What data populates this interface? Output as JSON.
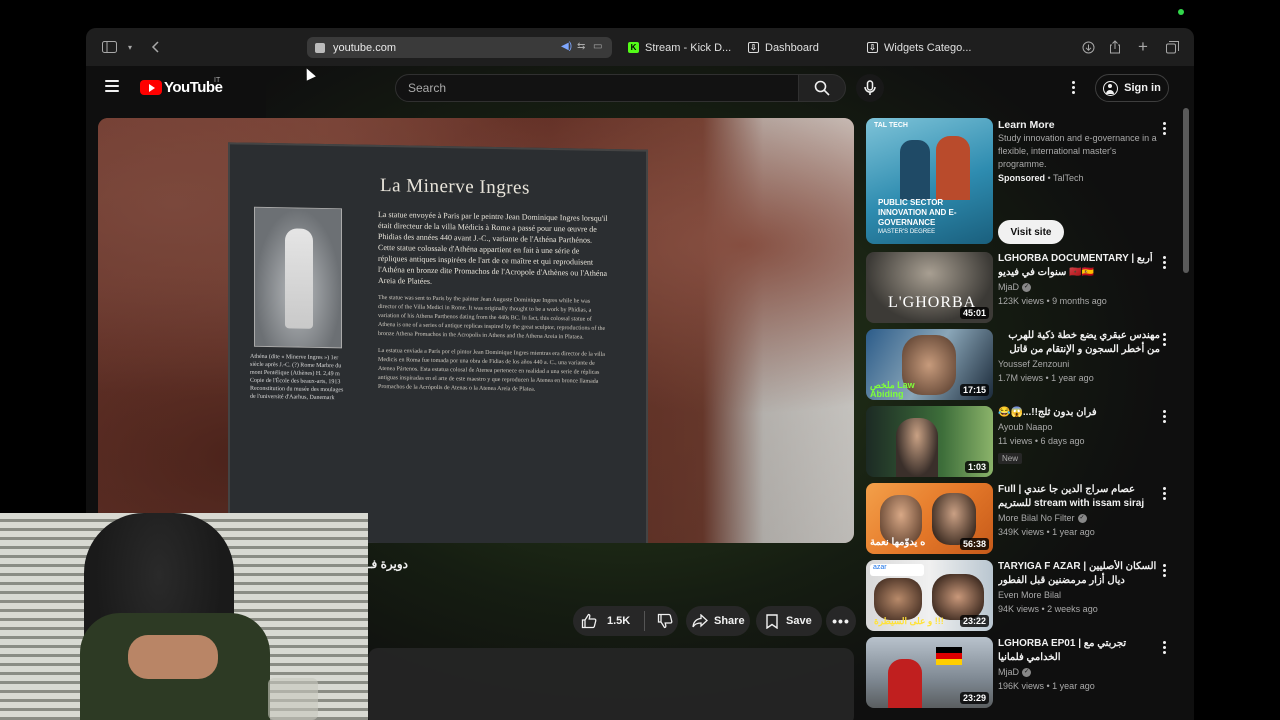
{
  "browser": {
    "address": "youtube.com",
    "tabs": [
      {
        "label": "Stream - Kick D...",
        "color": "#53fc18"
      },
      {
        "label": "Dashboard",
        "color": "#dddddd"
      },
      {
        "label": "Widgets Catego...",
        "color": "#dddddd"
      }
    ],
    "icons": [
      "sidebar-icon",
      "back-icon",
      "download-icon",
      "share-icon",
      "new-tab-icon",
      "tabs-overview-icon"
    ]
  },
  "yt": {
    "logo_text": "YouTube",
    "country_code": "IT",
    "search_placeholder": "Search",
    "signin_label": "Sign in",
    "brand_color": "#ff0000"
  },
  "video": {
    "plaque_title": "La Minerve Ingres",
    "plaque_fr": "La statue envoyée à Paris par le peintre Jean Dominique Ingres lorsqu'il était directeur de la villa Médicis à Rome a passé pour une œuvre de Phidias des années 440 avant J.-C., variante de l'Athéna Parthénos. Cette statue colossale d'Athéna appartient en fait à une série de répliques antiques inspirées de l'art de ce maître et qui reproduisent l'Athéna en bronze dite Promachos de l'Acropole d'Athènes ou l'Athéna Areia de Platées.",
    "plaque_en": "The statue was sent to Paris by the painter Jean Auguste Dominique Ingres while he was director of the Villa Medici in Rome. It was originally thought to be a work by Phidias, a variation of his Athena Parthenos dating from the 440s BC. In fact, this colossal statue of Athena is one of a series of antique replicas inspired by the great sculptor, reproductions of the bronze Athena Promachos in the Acropolis in Athens and the Athena Areia in Plataea.",
    "plaque_es": "La estatua enviada a París por el pintor Jean Dominique Ingres mientras era director de la villa Medicis en Roma fue tomada por una obra de Fidias de los años 440 a. C., una variante de Atenea Pártenos. Esta estatua colosal de Atenea pertenece en realidad a una serie de réplicas antiguas inspiradas en el arte de este maestro y que reproducen la Atenea en bronce llamada Promachos de la Acrópolis de Atenas o la Atenea Areia de Platea.",
    "plaque_caption": "Athéna (dite « Minerve Ingres »)  1er siècle après J.-C. (?)  Rome  Marbre du mont Pentélique (Athènes)  H. 2,49 m  Copie de l'École des beaux-arts, 1913  Reconstitution du musée des moulages de l'université d'Aarhus, Danemark",
    "title": "دويرة فـ",
    "likes": "1.5K",
    "share_label": "Share",
    "save_label": "Save"
  },
  "sidebar": {
    "ad": {
      "title": "Learn More",
      "body": "Study innovation and e-governance in a flexible, international master's programme.",
      "sponsored": "Sponsored",
      "advertiser": "TalTech",
      "cta": "Visit site",
      "thumb_text": "PUBLIC SECTOR INNOVATION AND E-GOVERNANCE",
      "thumb_sub": "MASTER'S DEGREE",
      "thumb_brand": "TAL TECH"
    },
    "videos": [
      {
        "title": "LGHORBA DOCUMENTARY | أربع سنوات في فيديو 🇲🇦🇪🇸",
        "channel": "MjaD",
        "verified": true,
        "meta": "123K views • 9 months ago",
        "duration": "45:01",
        "thumb_text": "L'GHORBA",
        "new": ""
      },
      {
        "title": "مهندس عبقري يضع خطة ذكية للهرب من أخطر السجون و الإنتقام من قاتل إبنته😱|...",
        "channel": "Youssef Zenzouni",
        "verified": false,
        "meta": "1.7M views • 1 year ago",
        "duration": "17:15",
        "thumb_text": "ملخص Law Abiding",
        "new": ""
      },
      {
        "title": "😂😱...!!فران بدون ثلج",
        "channel": "Ayoub Naapo",
        "verified": false,
        "meta": "11 views • 6 days ago",
        "duration": "1:03",
        "thumb_text": "",
        "new": "New"
      },
      {
        "title": "Full | عصام سراج الدين جا عندي للستريم stream with issam siraj eddine",
        "channel": "More Bilal No Filter",
        "verified": true,
        "meta": "349K views • 1 year ago",
        "duration": "56:38",
        "thumb_text": "ه يدوّمها نعمة",
        "new": ""
      },
      {
        "title": "TARYIGA F AZAR | السكان الأصليين ديال أزار مرمضنين قبل الفطور",
        "channel": "Even More Bilal",
        "verified": false,
        "meta": "94K views • 2 weeks ago",
        "duration": "23:22",
        "thumb_text": "و على السيطرة !!!",
        "new": ""
      },
      {
        "title": "LGHORBA EP01 | تجربتي مع الخدامي فلمانيا",
        "channel": "MjaD",
        "verified": true,
        "meta": "196K views • 1 year ago",
        "duration": "23:29",
        "thumb_text": "",
        "new": ""
      }
    ]
  }
}
